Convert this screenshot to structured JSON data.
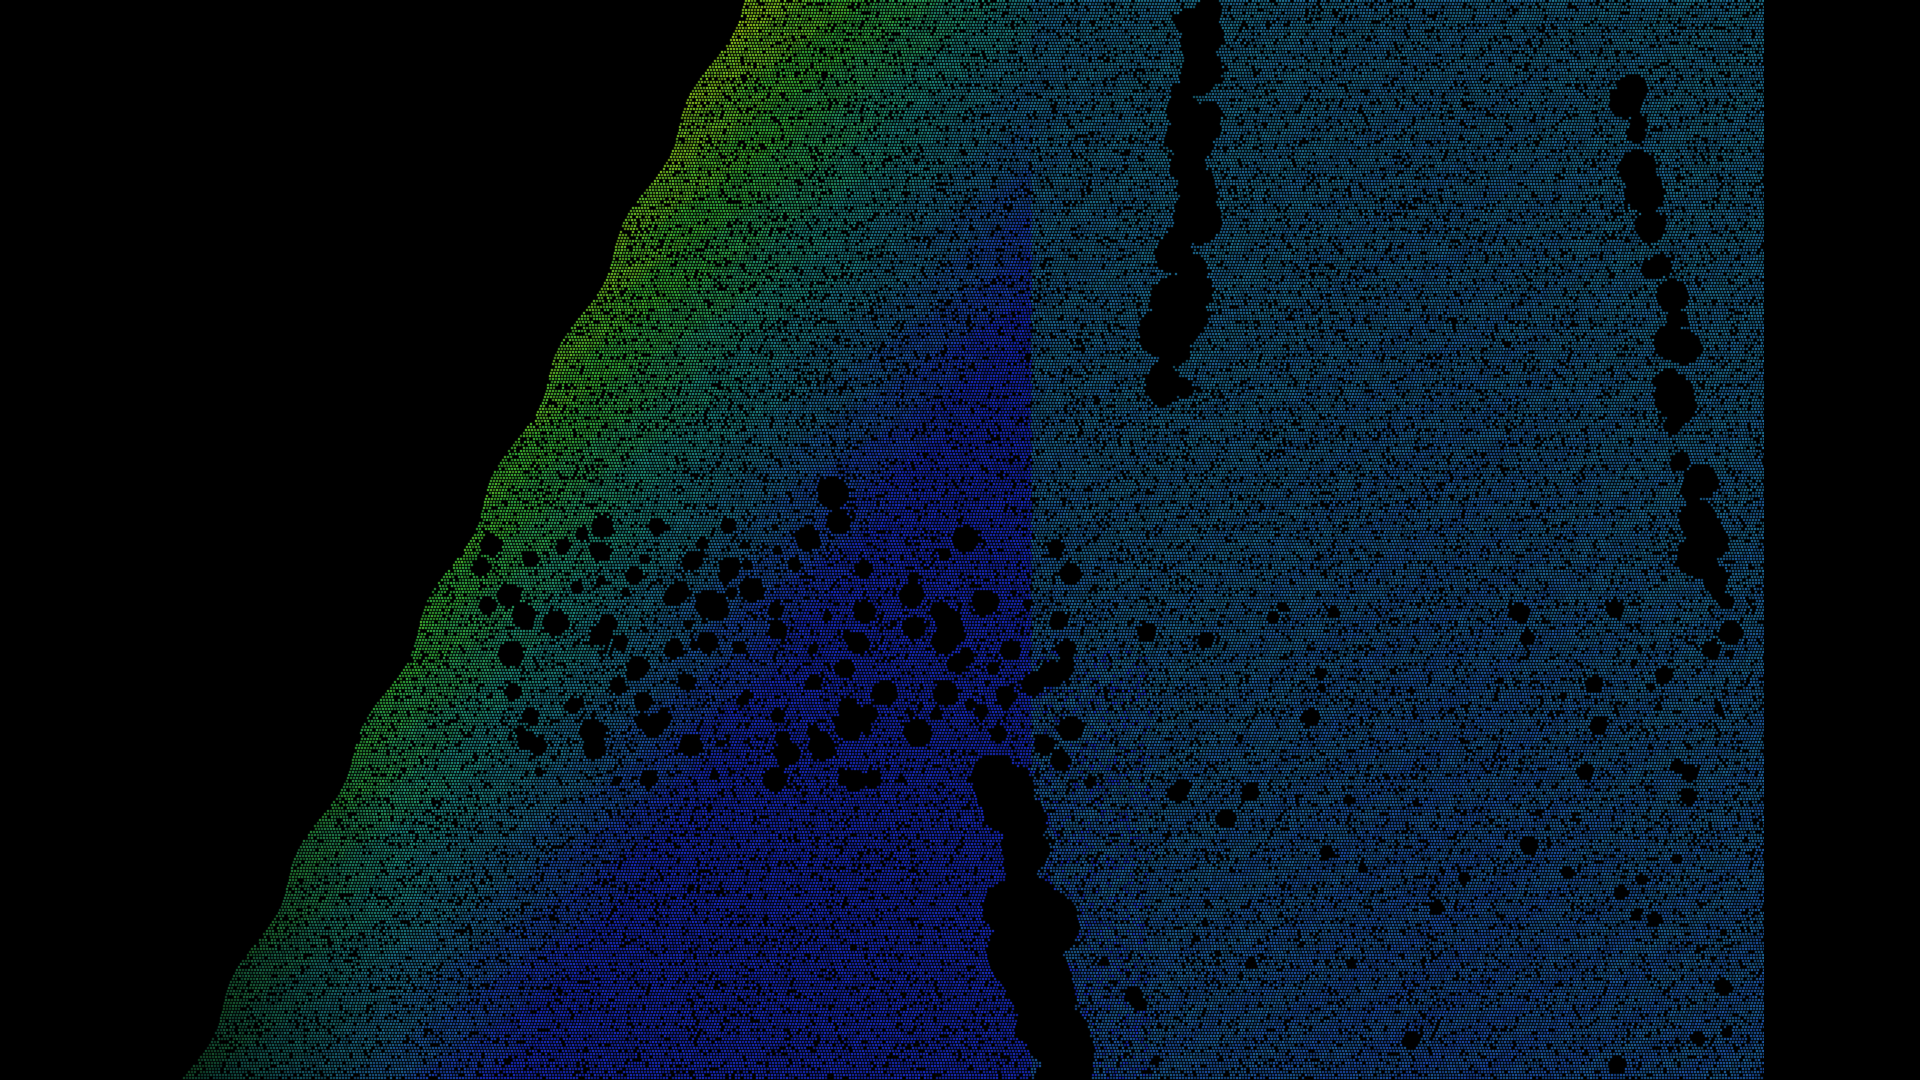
{
  "scene": {
    "subject": "point-cloud-height-map",
    "background_color": "#000000",
    "colormap": {
      "low": "#1a2fd6",
      "mid_low": "#1f6fa8",
      "mid": "#1f9a8c",
      "mid_high": "#39c43a",
      "high": "#b6e41a"
    },
    "icons": []
  }
}
